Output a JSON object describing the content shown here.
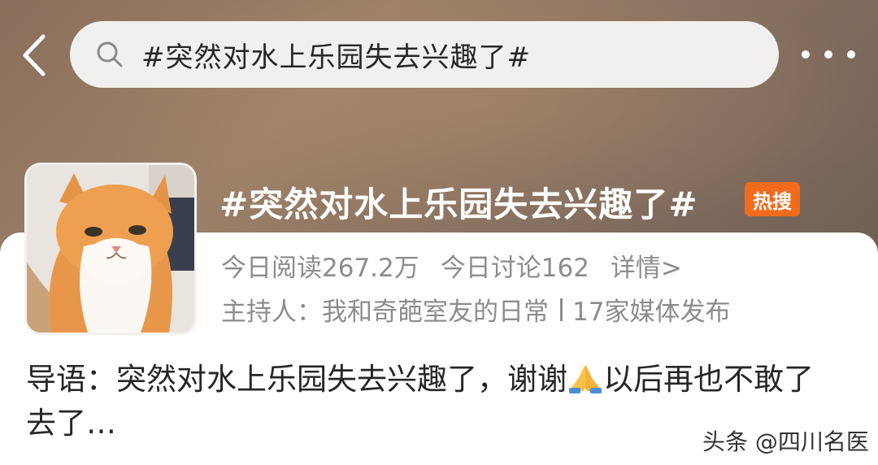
{
  "header": {
    "search_text": "#突然对水上乐园失去兴趣了#"
  },
  "topic": {
    "title": "#突然对水上乐园失去兴趣了#",
    "badge": "热搜",
    "reads": "今日阅读267.2万",
    "discussions": "今日讨论162",
    "detail_link": "详情>",
    "host": "主持人：我和奇葩室友的日常",
    "media": "17家媒体发布",
    "intro_part1": "导语：突然对水上乐园失去兴趣了，谢谢",
    "intro_part2": "以后再也不敢了去了…"
  },
  "watermark": "头条 @四川名医",
  "colors": {
    "badge_bg": "#f26a1b",
    "secondary_text": "#8c8c8c",
    "primary_text": "#262626"
  },
  "icons": [
    "back-arrow-icon",
    "search-icon",
    "more-icon",
    "praying-hands-icon",
    "cat-avatar"
  ]
}
